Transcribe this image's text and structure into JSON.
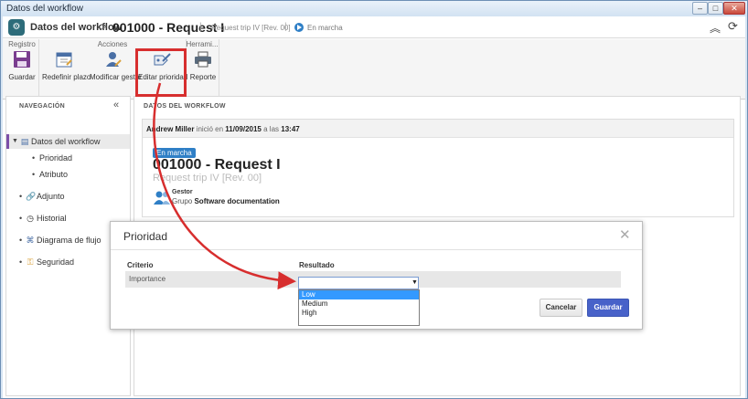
{
  "window": {
    "title": "Datos del workflow"
  },
  "header": {
    "title": "Datos del workflow",
    "separator": ">",
    "record": "001000 - Request I",
    "subtitle": "Request trip IV [Rev. 00]",
    "status": "En marcha",
    "divider": "|"
  },
  "ribbon": {
    "groups": {
      "registro": "Registro",
      "acciones": "Acciones",
      "herramientas": "Herrami..."
    },
    "buttons": {
      "save": "Guardar",
      "redefine": "Redefinir plazo",
      "modify_manager": "Modificar gestor",
      "edit_priority": "Editar prioridad",
      "report": "Reporte"
    }
  },
  "nav": {
    "heading": "NAVEGACIÓN",
    "collapse": "«",
    "items": [
      {
        "label": "Datos del workflow"
      },
      {
        "label": "Prioridad"
      },
      {
        "label": "Atributo"
      },
      {
        "label": "Adjunto"
      },
      {
        "label": "Historial"
      },
      {
        "label": "Diagrama de flujo"
      },
      {
        "label": "Seguridad"
      }
    ]
  },
  "main": {
    "heading": "DATOS DEL WORKFLOW",
    "started": {
      "user": "Andrew Miller",
      "text1": "inició en",
      "date": "11/09/2015",
      "text2": "a las",
      "time": "13:47"
    },
    "badge": "En marcha",
    "record_title": "001000 - Request I",
    "record_sub": "Request trip IV [Rev. 00]",
    "gestor_label": "Gestor",
    "gestor_prefix": "Grupo",
    "gestor_value": "Software documentation"
  },
  "dialog": {
    "title": "Prioridad",
    "close": "✕",
    "col_criterio": "Criterio",
    "col_resultado": "Resultado",
    "row_criterio": "Importance",
    "select_value": "",
    "options": [
      "Low",
      "Medium",
      "High"
    ],
    "highlighted_option": "Low",
    "cancel": "Cancelar",
    "save": "Guardar"
  },
  "colors": {
    "accent": "#2f7fc6",
    "primary_button": "#4862c9",
    "annotation": "#d72e2e",
    "active_nav": "#7d4fa8"
  }
}
